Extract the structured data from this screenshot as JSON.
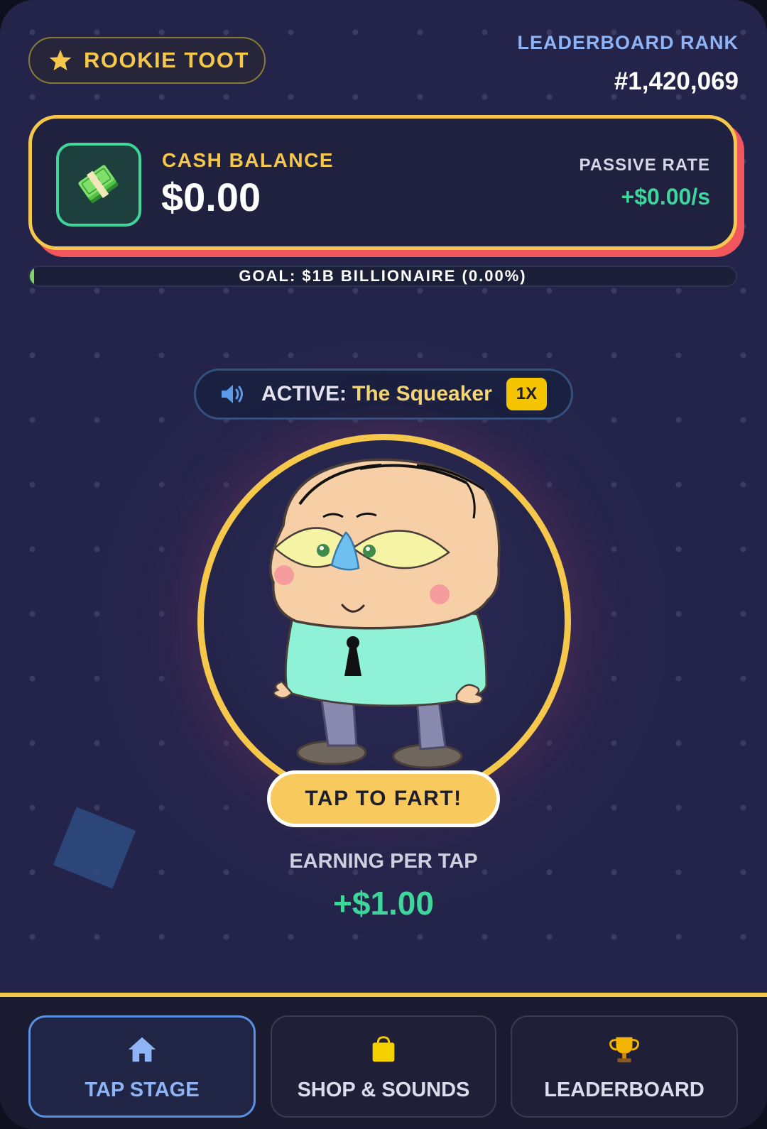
{
  "header": {
    "badge_icon": "star-icon",
    "badge_label": "ROOKIE TOOT",
    "rank_label": "LEADERBOARD RANK",
    "rank_value": "#1,420,069"
  },
  "balance_card": {
    "icon": "cash-stack-icon",
    "cash_label": "CASH BALANCE",
    "cash_value": "$0.00",
    "passive_label": "PASSIVE RATE",
    "passive_value": "+$0.00/s"
  },
  "goal": {
    "text": "GOAL: $1B BILLIONAIRE (0.00%)",
    "progress_percent": 0.0
  },
  "active_sound": {
    "icon": "speaker-icon",
    "label": "ACTIVE:",
    "name": "The Squeaker",
    "multiplier": "1X"
  },
  "stage": {
    "tap_button_label": "TAP TO FART!",
    "earning_label": "EARNING PER TAP",
    "earning_value": "+$1.00"
  },
  "nav": {
    "items": [
      {
        "label": "TAP STAGE",
        "icon": "home-icon",
        "active": true
      },
      {
        "label": "SHOP & SOUNDS",
        "icon": "shopping-bag-icon",
        "active": false
      },
      {
        "label": "LEADERBOARD",
        "icon": "trophy-icon",
        "active": false
      }
    ]
  },
  "colors": {
    "background": "#24244a",
    "accent_gold": "#f5c84c",
    "accent_green": "#3ed69a",
    "accent_blue": "#8fb4f5",
    "card_shadow_red": "#f0565c"
  }
}
